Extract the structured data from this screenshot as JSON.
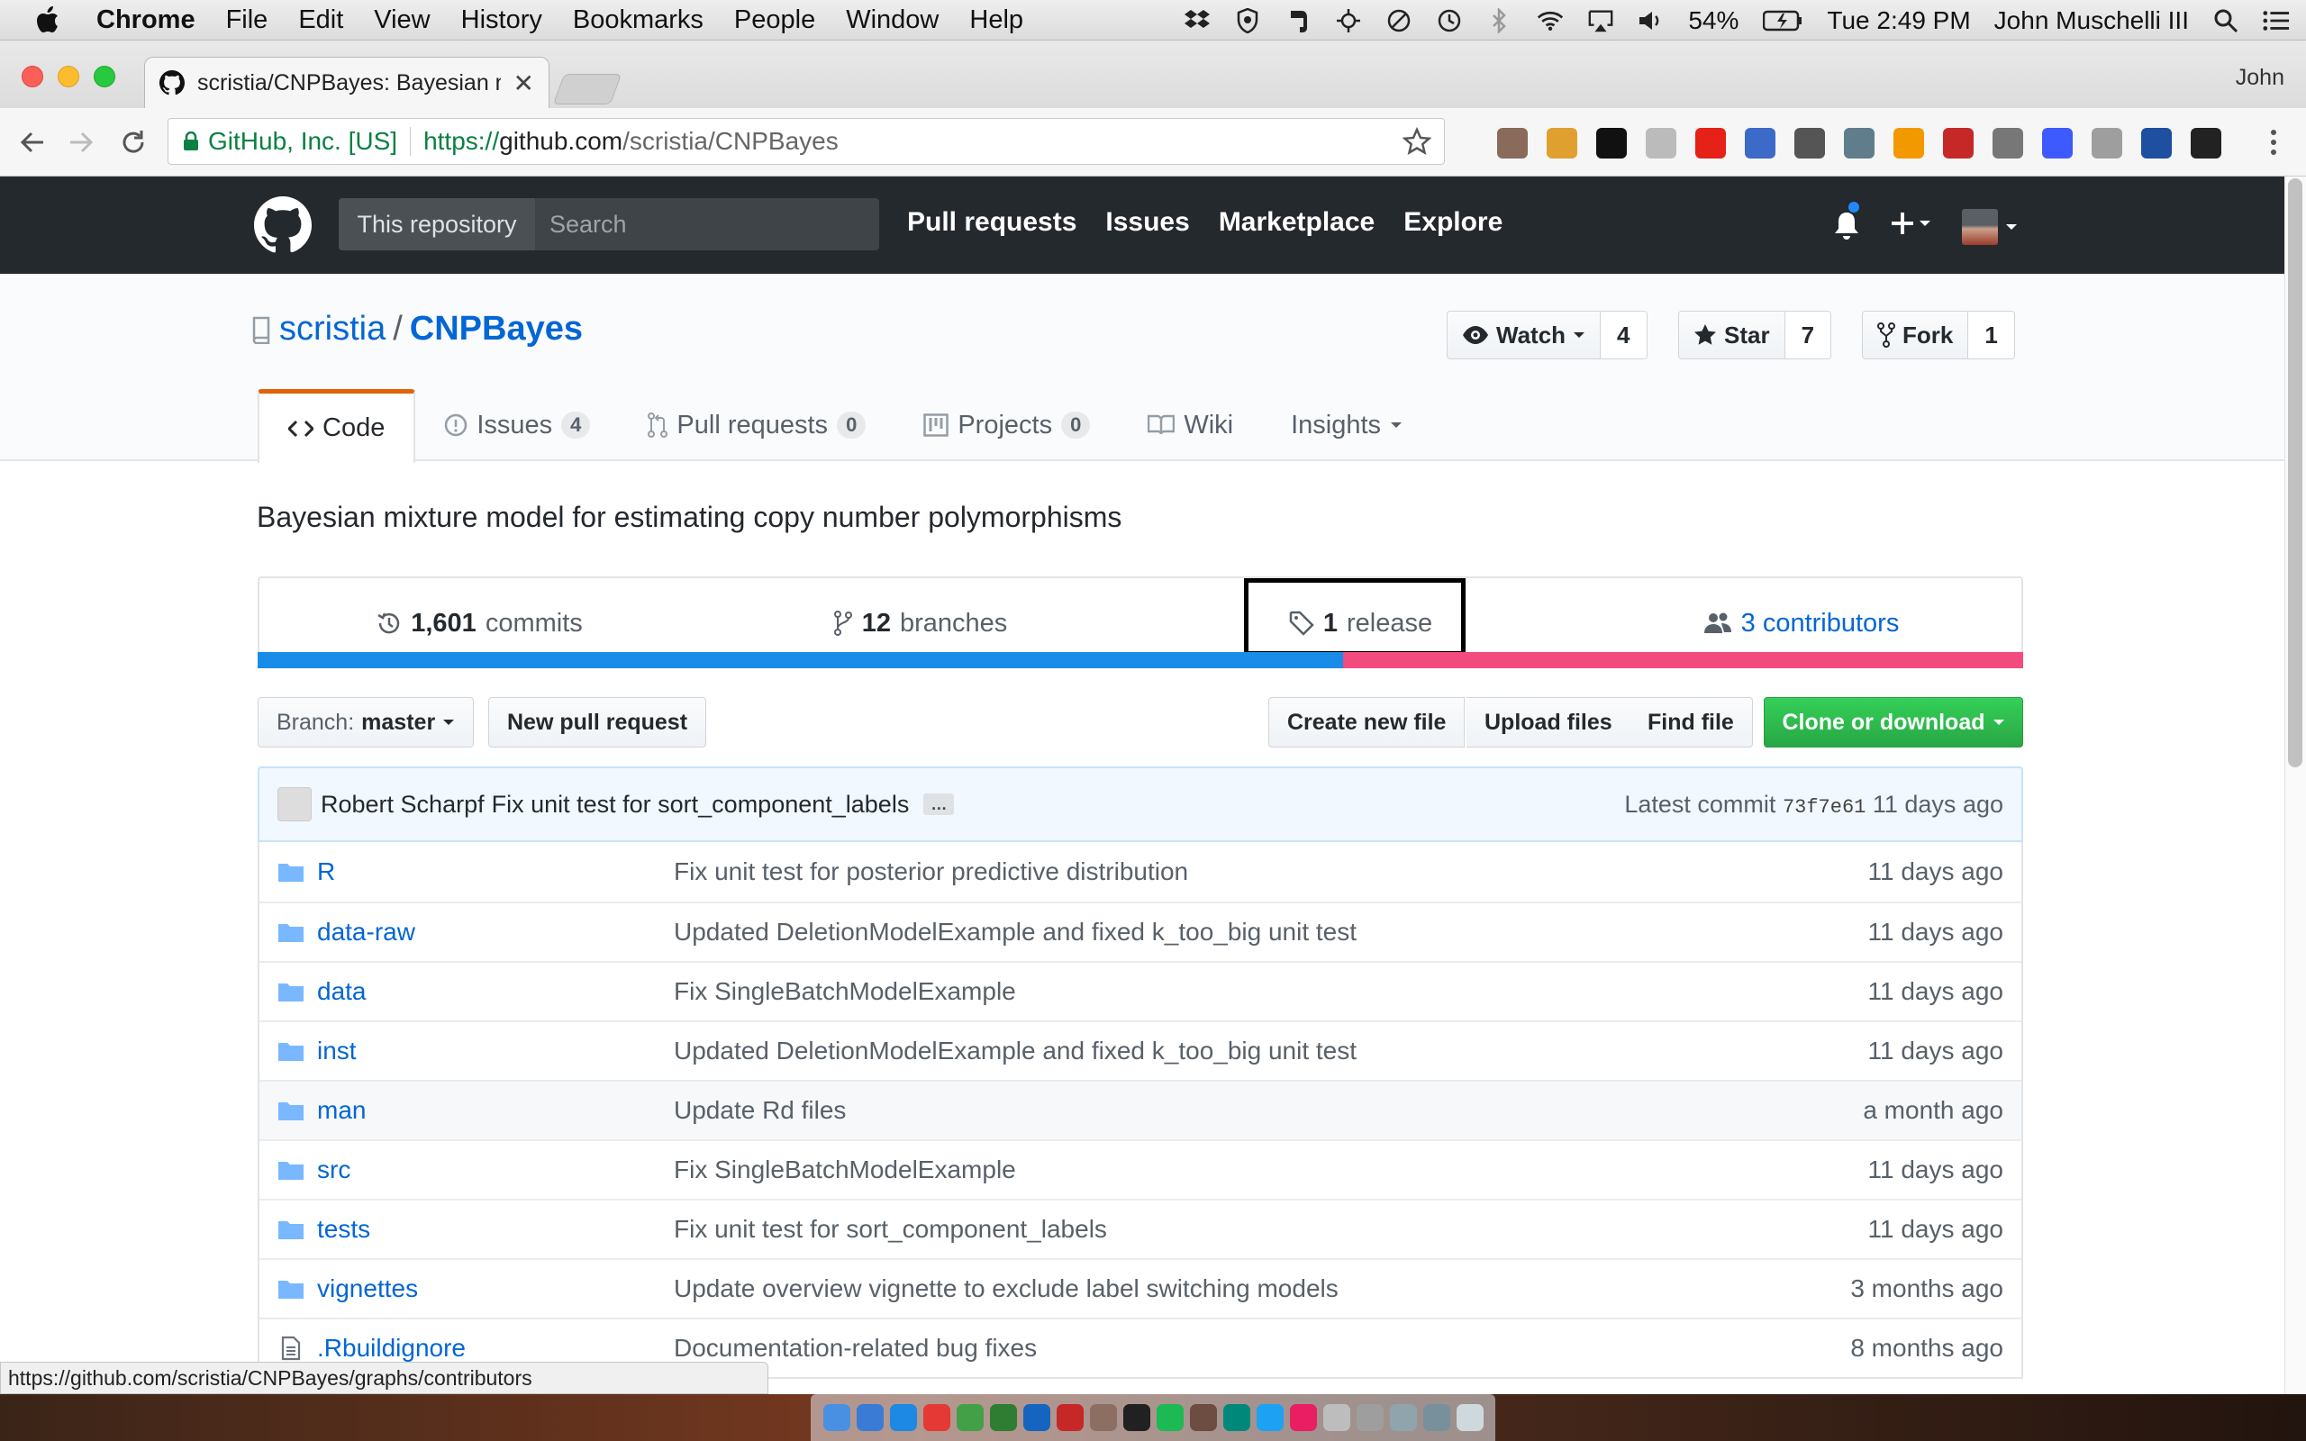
{
  "menubar": {
    "app": "Chrome",
    "items": [
      "File",
      "Edit",
      "View",
      "History",
      "Bookmarks",
      "People",
      "Window",
      "Help"
    ],
    "battery": "54%",
    "clock": "Tue 2:49 PM",
    "user": "John Muschelli III"
  },
  "browser": {
    "tab_title": "scristia/CNPBayes: Bayesian m",
    "profile": "John",
    "secure_label": "GitHub, Inc. [US]",
    "url_scheme": "https://",
    "url_host": "github.com",
    "url_path": "/scristia/CNPBayes",
    "extension_icons": [
      "ext-1",
      "ext-2",
      "ext-3",
      "ext-4",
      "ext-5",
      "ext-6",
      "ext-7",
      "ext-8",
      "ext-9",
      "ext-10",
      "ext-11",
      "ext-12",
      "ext-13",
      "ext-14",
      "ext-15"
    ]
  },
  "github": {
    "search_scope": "This repository",
    "search_placeholder": "Search",
    "nav": [
      "Pull requests",
      "Issues",
      "Marketplace",
      "Explore"
    ]
  },
  "repo": {
    "owner": "scristia",
    "slash": "/",
    "name": "CNPBayes",
    "watch_label": "Watch",
    "watch_count": "4",
    "star_label": "Star",
    "star_count": "7",
    "fork_label": "Fork",
    "fork_count": "1",
    "tabs": [
      {
        "label": "Code",
        "count": ""
      },
      {
        "label": "Issues",
        "count": "4"
      },
      {
        "label": "Pull requests",
        "count": "0"
      },
      {
        "label": "Projects",
        "count": "0"
      },
      {
        "label": "Wiki",
        "count": ""
      },
      {
        "label": "Insights",
        "count": ""
      }
    ],
    "description": "Bayesian mixture model for estimating copy number polymorphisms",
    "summary": {
      "commits_num": "1,601",
      "commits_label": "commits",
      "branches_num": "12",
      "branches_label": "branches",
      "release_num": "1",
      "release_label": "release",
      "contributors_label": "3 contributors"
    },
    "languages": [
      {
        "color": "#198ce7",
        "share": 0.615
      },
      {
        "color": "#f34b7d",
        "share": 0.385
      }
    ]
  },
  "filenav": {
    "branch_prefix": "Branch:",
    "branch_name": "master",
    "new_pr": "New pull request",
    "create_file": "Create new file",
    "upload_files": "Upload files",
    "find_file": "Find file",
    "clone": "Clone or download"
  },
  "latest_commit": {
    "author": "Robert Scharpf",
    "message": "Fix unit test for sort_component_labels",
    "ellipsis": "…",
    "prefix": "Latest commit",
    "sha": "73f7e61",
    "age": "11 days ago"
  },
  "files": [
    {
      "type": "dir",
      "name": "R",
      "message": "Fix unit test for posterior predictive distribution",
      "age": "11 days ago"
    },
    {
      "type": "dir",
      "name": "data-raw",
      "message": "Updated DeletionModelExample and fixed k_too_big unit test",
      "age": "11 days ago"
    },
    {
      "type": "dir",
      "name": "data",
      "message": "Fix SingleBatchModelExample",
      "age": "11 days ago"
    },
    {
      "type": "dir",
      "name": "inst",
      "message": "Updated DeletionModelExample and fixed k_too_big unit test",
      "age": "11 days ago"
    },
    {
      "type": "dir",
      "name": "man",
      "message": "Update Rd files",
      "age": "a month ago"
    },
    {
      "type": "dir",
      "name": "src",
      "message": "Fix SingleBatchModelExample",
      "age": "11 days ago"
    },
    {
      "type": "dir",
      "name": "tests",
      "message": "Fix unit test for sort_component_labels",
      "age": "11 days ago"
    },
    {
      "type": "dir",
      "name": "vignettes",
      "message": "Update overview vignette to exclude label switching models",
      "age": "3 months ago"
    },
    {
      "type": "file",
      "name": ".Rbuildignore",
      "message": "Documentation-related bug fixes",
      "age": "8 months ago"
    }
  ],
  "status_url": "https://github.com/scristia/CNPBayes/graphs/contributors",
  "colors": {
    "accent": "#0366d6",
    "header": "#24292e",
    "green": "#28a745",
    "tab_border": "#e36209"
  }
}
